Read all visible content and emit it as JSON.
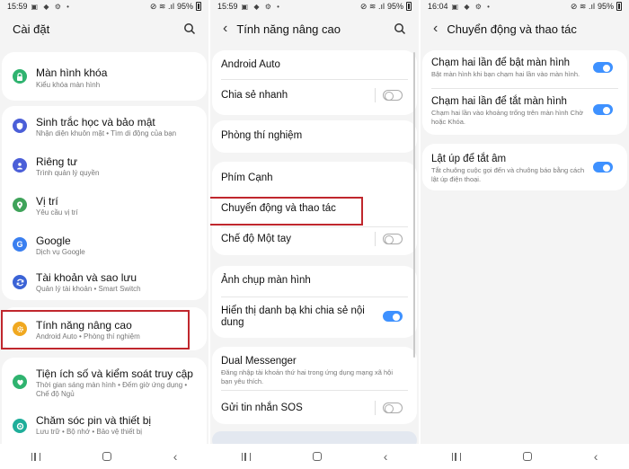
{
  "screen1": {
    "status": {
      "time": "15:59",
      "battery": "95%"
    },
    "title": "Cài đặt",
    "items": [
      {
        "title": "Màn hình khóa",
        "sub": "Kiểu khóa màn hình",
        "icon_color": "#2fb36f",
        "icon": "lock-icon"
      },
      {
        "title": "Sinh trắc học và bảo mật",
        "sub": "Nhận diện khuôn mặt  •  Tìm di động của bạn",
        "icon_color": "#4b5fd8",
        "icon": "shield-icon"
      },
      {
        "title": "Riêng tư",
        "sub": "Trình quản lý quyền",
        "icon_color": "#4b5fd8",
        "icon": "privacy-icon"
      },
      {
        "title": "Vị trí",
        "sub": "Yêu cầu vị trí",
        "icon_color": "#3fa35a",
        "icon": "location-icon"
      },
      {
        "title": "Google",
        "sub": "Dịch vụ Google",
        "icon_color": "#3a7ff0",
        "icon": "google-icon"
      },
      {
        "title": "Tài khoản và sao lưu",
        "sub": "Quản lý tài khoản  •  Smart Switch",
        "icon_color": "#3b63d6",
        "icon": "sync-icon"
      },
      {
        "title": "Tính năng nâng cao",
        "sub": "Android Auto  •  Phòng thí nghiệm",
        "icon_color": "#f0a820",
        "icon": "gear-plus-icon"
      },
      {
        "title": "Tiện ích số và kiểm soát truy cập",
        "sub": "Thời gian sáng màn hình  •  Đếm giờ ứng dụng  •  Chế độ Ngủ",
        "icon_color": "#2fb36f",
        "icon": "wellbeing-icon"
      },
      {
        "title": "Chăm sóc pin và thiết bị",
        "sub": "Lưu trữ  •  Bộ nhớ  •  Bảo vệ thiết bị",
        "icon_color": "#1fae9a",
        "icon": "device-care-icon"
      }
    ]
  },
  "screen2": {
    "status": {
      "time": "15:59",
      "battery": "95%"
    },
    "title": "Tính năng nâng cao",
    "items": {
      "android_auto": "Android Auto",
      "quick_share": "Chia sẻ nhanh",
      "labs": "Phòng thí nghiệm",
      "side_key": "Phím Cạnh",
      "motions": "Chuyển động và thao tác",
      "one_hand": "Chế độ Một tay",
      "screenshot": "Ảnh chụp màn hình",
      "show_contacts": "Hiển thị danh bạ khi chia sẻ nội dung",
      "dual_messenger": "Dual Messenger",
      "dual_messenger_sub": "Đăng nhập tài khoản thứ hai trong ứng dụng mạng xã hội bạn yêu thích.",
      "send_sos": "Gửi tin nhắn SOS"
    },
    "toggles": {
      "quick_share": false,
      "one_hand": false,
      "show_contacts": true,
      "send_sos": false
    }
  },
  "screen3": {
    "status": {
      "time": "16:04",
      "battery": "95%"
    },
    "title": "Chuyển động và thao tác",
    "items": {
      "double_tap_on": "Chạm hai lần để bật màn hình",
      "double_tap_on_sub": "Bật màn hình khi bạn chạm hai lần vào màn hình.",
      "double_tap_off": "Chạm hai lần để tắt màn hình",
      "double_tap_off_sub": "Chạm hai lần vào khoảng trống trên màn hình Chờ hoặc Khóa.",
      "flip_mute": "Lật úp để tắt âm",
      "flip_mute_sub": "Tắt chuông cuộc gọi đến và chuông báo bằng cách lật úp điện thoại."
    },
    "toggles": {
      "double_tap_on": true,
      "double_tap_off": true,
      "flip_mute": true
    }
  },
  "colors": {
    "accent": "#3e91ff",
    "highlight": "#c0272d",
    "background": "#f4f4f4"
  }
}
